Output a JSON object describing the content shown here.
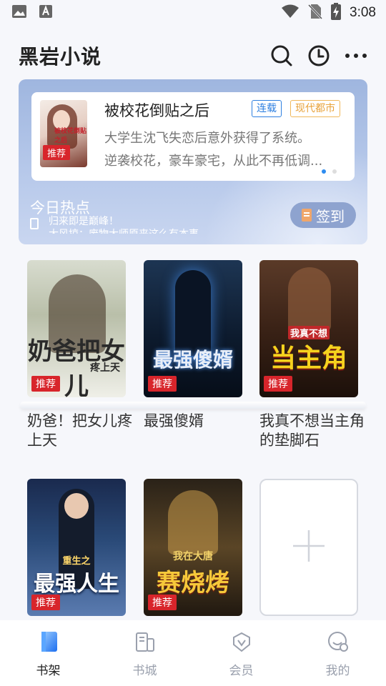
{
  "status_bar": {
    "time": "3:08",
    "left_icons": [
      "image-icon",
      "notification-a-icon"
    ],
    "right_icons": [
      "wifi-icon",
      "no-sim-icon",
      "battery-charging-icon"
    ]
  },
  "header": {
    "title": "黑岩小说",
    "actions": [
      "search-icon",
      "history-clock-icon",
      "more-icon"
    ]
  },
  "banner": {
    "featured": {
      "title": "被校花倒贴之后",
      "tag_status": "连载",
      "tag_genre": "现代都市",
      "cover_badge": "推荐",
      "desc_line1": "大学生沈飞失恋后意外获得了系统。",
      "desc_line2": "逆袭校花，豪车豪宅，从此不再低调..."
    },
    "pager": {
      "count": 2,
      "active": 0
    },
    "hot_title": "今日热点",
    "hot_line1": "归来即是巅峰！",
    "hot_line2": "大风掠：废物大师原来这么有本事",
    "sign_in_label": "签到"
  },
  "shelf": {
    "badge_label": "推荐",
    "books": [
      {
        "name": "奶爸！把女儿疼上天",
        "cover_text": "奶爸把女儿",
        "cover_sub": "疼上天"
      },
      {
        "name": "最强傻婿",
        "cover_text": "最强傻婿",
        "cover_sub": ""
      },
      {
        "name": "我真不想当主角的垫脚石",
        "cover_text": "当主角",
        "cover_sub": "我真不想"
      },
      {
        "name": "",
        "cover_text": "最强人生",
        "cover_sub": "重生之"
      },
      {
        "name": "",
        "cover_text": "赛烧烤",
        "cover_sub": "我在大唐"
      }
    ],
    "add_icon": "plus-icon"
  },
  "bottom_nav": {
    "active": 0,
    "items": [
      {
        "label": "书架",
        "icon": "bookshelf-icon"
      },
      {
        "label": "书城",
        "icon": "bookstore-icon"
      },
      {
        "label": "会员",
        "icon": "vip-icon"
      },
      {
        "label": "我的",
        "icon": "profile-icon"
      }
    ]
  },
  "colors": {
    "accent": "#2d8cf0",
    "badge_red": "#d8252b",
    "banner_bg": "#a9bde4",
    "tag_blue": "#2d7fe0",
    "tag_orange": "#e8a23a"
  }
}
